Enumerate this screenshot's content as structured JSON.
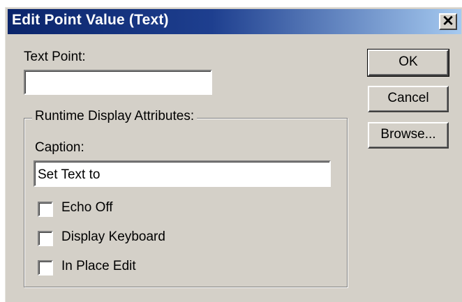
{
  "dialog": {
    "title": "Edit Point Value (Text)",
    "close_glyph": "✕",
    "text_point_label": "Text Point:",
    "text_point_value": "",
    "group_label": "Runtime Display Attributes:",
    "caption_label": "Caption:",
    "caption_value": "Set Text to",
    "checkboxes": [
      {
        "label": "Echo Off",
        "checked": false
      },
      {
        "label": "Display Keyboard",
        "checked": false
      },
      {
        "label": "In Place Edit",
        "checked": false
      }
    ],
    "buttons": {
      "ok": "OK",
      "cancel": "Cancel",
      "browse": "Browse..."
    }
  },
  "colors": {
    "face": "#d4d0c8",
    "title_start": "#0a246a",
    "title_end": "#a6caf0"
  }
}
